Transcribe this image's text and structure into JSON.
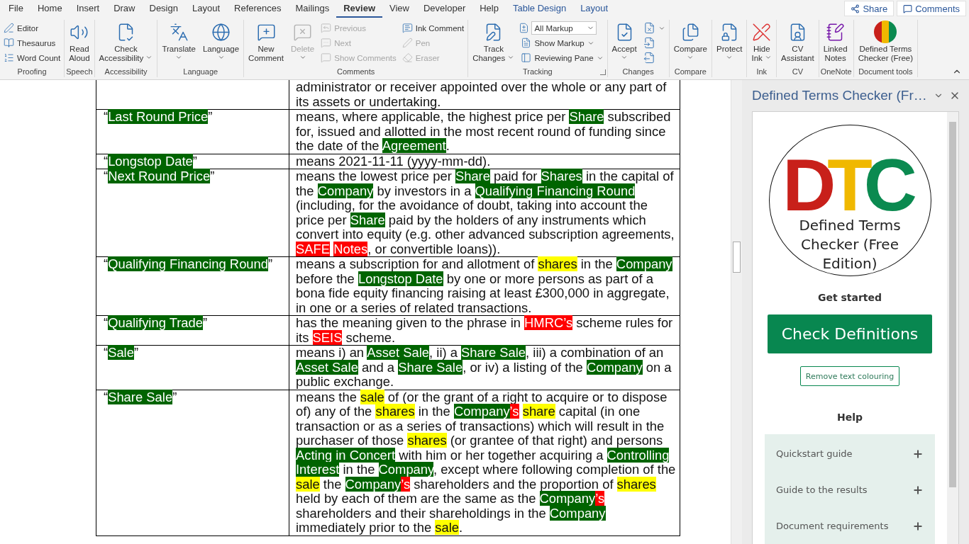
{
  "menu_tabs": [
    {
      "label": "File",
      "selected": false,
      "kind": "main"
    },
    {
      "label": "Home",
      "selected": false,
      "kind": "main"
    },
    {
      "label": "Insert",
      "selected": false,
      "kind": "main"
    },
    {
      "label": "Draw",
      "selected": false,
      "kind": "main"
    },
    {
      "label": "Design",
      "selected": false,
      "kind": "main"
    },
    {
      "label": "Layout",
      "selected": false,
      "kind": "main"
    },
    {
      "label": "References",
      "selected": false,
      "kind": "main"
    },
    {
      "label": "Mailings",
      "selected": false,
      "kind": "main"
    },
    {
      "label": "Review",
      "selected": true,
      "kind": "main"
    },
    {
      "label": "View",
      "selected": false,
      "kind": "main"
    },
    {
      "label": "Developer",
      "selected": false,
      "kind": "main"
    },
    {
      "label": "Help",
      "selected": false,
      "kind": "main"
    },
    {
      "label": "Table Design",
      "selected": false,
      "kind": "contextual"
    },
    {
      "label": "Layout",
      "selected": false,
      "kind": "contextual"
    }
  ],
  "share_button": "Share",
  "comments_button": "Comments",
  "ribbon_groups": [
    {
      "label": "Proofing",
      "items": [
        {
          "kind": "stack",
          "items": [
            {
              "kind": "small",
              "label": "Editor",
              "disabled": false
            },
            {
              "kind": "small",
              "label": "Thesaurus",
              "disabled": false
            },
            {
              "kind": "small",
              "label": "Word Count",
              "disabled": false
            }
          ]
        }
      ]
    },
    {
      "label": "Speech",
      "items": [
        {
          "kind": "large",
          "label": "Read\nAloud",
          "disabled": false
        }
      ]
    },
    {
      "label": "Accessibility",
      "items": [
        {
          "kind": "large",
          "label": "Check\nAccessibility",
          "menu": true,
          "disabled": false
        }
      ]
    },
    {
      "label": "Language",
      "items": [
        {
          "kind": "large",
          "label": "Translate",
          "menu": true,
          "disabled": false
        },
        {
          "kind": "large",
          "label": "Language",
          "menu": true,
          "disabled": false
        }
      ]
    },
    {
      "label": "Comments",
      "items": [
        {
          "kind": "large",
          "label": "New\nComment",
          "disabled": false
        },
        {
          "kind": "large",
          "label": "Delete",
          "menu": true,
          "disabled": true
        },
        {
          "kind": "stack",
          "items": [
            {
              "kind": "small",
              "label": "Previous",
              "disabled": true
            },
            {
              "kind": "small",
              "label": "Next",
              "disabled": true
            },
            {
              "kind": "small",
              "label": "Show Comments",
              "disabled": true
            }
          ]
        },
        {
          "kind": "stack",
          "items": [
            {
              "kind": "small",
              "label": "Ink Comment",
              "disabled": false
            },
            {
              "kind": "small",
              "label": "Pen",
              "disabled": true
            },
            {
              "kind": "small",
              "label": "Eraser",
              "disabled": true
            }
          ]
        }
      ]
    },
    {
      "label": "Tracking",
      "launcher": true,
      "items": [
        {
          "kind": "large",
          "label": "Track\nChanges",
          "menu": true,
          "disabled": false
        },
        {
          "kind": "stack",
          "items": [
            {
              "kind": "select",
              "label": "All Markup"
            },
            {
              "kind": "small",
              "label": "Show Markup",
              "menu": true,
              "disabled": false
            },
            {
              "kind": "small",
              "label": "Reviewing Pane",
              "menu": true,
              "disabled": false
            }
          ]
        }
      ]
    },
    {
      "label": "Changes",
      "items": [
        {
          "kind": "large",
          "label": "Accept",
          "menu": true,
          "disabled": false
        },
        {
          "kind": "stack",
          "items": [
            {
              "kind": "icon",
              "menu": true,
              "disabled": false
            },
            {
              "kind": "icon",
              "disabled": false
            },
            {
              "kind": "icon",
              "disabled": false
            }
          ]
        }
      ]
    },
    {
      "label": "Compare",
      "items": [
        {
          "kind": "large",
          "label": "Compare",
          "menu": true,
          "disabled": false
        }
      ]
    },
    {
      "items": [
        {
          "kind": "large",
          "label": "Protect",
          "menu": true,
          "disabled": false
        }
      ]
    },
    {
      "label": "Ink",
      "items": [
        {
          "kind": "large",
          "label": "Hide\nInk",
          "menu": true,
          "disabled": false
        }
      ]
    },
    {
      "label": "CV",
      "items": [
        {
          "kind": "large",
          "label": "CV\nAssistant",
          "disabled": false
        }
      ]
    },
    {
      "label": "OneNote",
      "items": [
        {
          "kind": "large",
          "label": "Linked\nNotes",
          "disabled": false
        }
      ]
    },
    {
      "label": "Document tools",
      "items": [
        {
          "kind": "large",
          "label": "Defined Terms\nChecker (Free)",
          "disabled": false
        }
      ]
    }
  ],
  "table": {
    "rows": [
      {
        "term": [],
        "definition": [
          {
            "text": "administrator or receiver appointed over the whole or any part of its assets or undertaking."
          }
        ]
      },
      {
        "term": [
          {
            "text": "“"
          },
          {
            "text": "Last Round Price",
            "color": "#006400"
          },
          {
            "text": "”"
          }
        ],
        "definition": [
          {
            "text": "means, where applicable, the highest price per "
          },
          {
            "text": "Share",
            "color": "#006400"
          },
          {
            "text": " subscribed for, issued and allotted in the most recent round of funding since the date of the "
          },
          {
            "text": "Agreement",
            "color": "#006400"
          },
          {
            "text": "."
          }
        ]
      },
      {
        "term": [
          {
            "text": "“"
          },
          {
            "text": "Longstop Date",
            "color": "#006400"
          },
          {
            "text": "”"
          }
        ],
        "definition": [
          {
            "text": "means 2021-11-11 (yyyy-mm-dd)."
          }
        ]
      },
      {
        "term": [
          {
            "text": "“"
          },
          {
            "text": "Next Round Price",
            "color": "#006400"
          },
          {
            "text": "”"
          }
        ],
        "definition": [
          {
            "text": "means the lowest price per "
          },
          {
            "text": "Share",
            "color": "#006400"
          },
          {
            "text": " paid for "
          },
          {
            "text": "Shares",
            "color": "#006400"
          },
          {
            "text": " in the capital of the "
          },
          {
            "text": "Company",
            "color": "#006400"
          },
          {
            "text": " by investors in a "
          },
          {
            "text": "Qualifying Financing Round",
            "color": "#006400"
          },
          {
            "text": " (including, for the avoidance of doubt, taking into account the price per "
          },
          {
            "text": "Share",
            "color": "#006400"
          },
          {
            "text": " paid by the holders of any instruments which convert into equity (e.g. other advanced subscription agreements, "
          },
          {
            "text": "SAFE",
            "color": "#ff0000"
          },
          {
            "text": "Notes",
            "color": "#ff0000",
            "space_before": true
          },
          {
            "text": ", or convertible loans))."
          }
        ]
      },
      {
        "term": [
          {
            "text": "“"
          },
          {
            "text": "Qualifying Financing Round",
            "color": "#006400"
          },
          {
            "text": "”"
          }
        ],
        "definition": [
          {
            "text": "means a subscription for and allotment of "
          },
          {
            "text": "shares",
            "color": "#ffff00"
          },
          {
            "text": " in the "
          },
          {
            "text": "Company",
            "color": "#006400"
          },
          {
            "text": " before the "
          },
          {
            "text": "Longstop Date",
            "color": "#006400"
          },
          {
            "text": " by one or more persons as part of a bona fide equity financing raising at least £300,000 in aggregate, in one or a series of related transactions."
          }
        ]
      },
      {
        "term": [
          {
            "text": "“"
          },
          {
            "text": "Qualifying Trade",
            "color": "#006400"
          },
          {
            "text": "”"
          }
        ],
        "definition": [
          {
            "text": "has the meaning given to the phrase in "
          },
          {
            "text": "HMRC’s",
            "color": "#ff0000"
          },
          {
            "text": " scheme rules for its "
          },
          {
            "text": "SEIS",
            "color": "#ff0000"
          },
          {
            "text": " scheme."
          }
        ]
      },
      {
        "term": [
          {
            "text": "“"
          },
          {
            "text": "Sale",
            "color": "#006400"
          },
          {
            "text": "”"
          }
        ],
        "definition": [
          {
            "text": "means i) an "
          },
          {
            "text": "Asset Sale",
            "color": "#006400"
          },
          {
            "text": ", ii) a "
          },
          {
            "text": "Share Sale",
            "color": "#006400"
          },
          {
            "text": ", iii) a combination of an "
          },
          {
            "text": "Asset Sale",
            "color": "#006400"
          },
          {
            "text": " and a "
          },
          {
            "text": "Share Sale",
            "color": "#006400"
          },
          {
            "text": ", or iv) a listing of the "
          },
          {
            "text": "Company",
            "color": "#006400"
          },
          {
            "text": " on a public exchange."
          }
        ]
      },
      {
        "term": [
          {
            "text": "“"
          },
          {
            "text": "Share Sale",
            "color": "#006400"
          },
          {
            "text": "”"
          }
        ],
        "definition": [
          {
            "text": "means the "
          },
          {
            "text": "sale",
            "color": "#ffff00"
          },
          {
            "text": " of (or the grant of a right to acquire or to dispose of) any of the "
          },
          {
            "text": "shares",
            "color": "#ffff00"
          },
          {
            "text": " in the "
          },
          {
            "text": "Company",
            "color": "#006400"
          },
          {
            "text": "’s",
            "color": "#ff0000"
          },
          {
            "text": "share",
            "color": "#ffff00",
            "space_before": true
          },
          {
            "text": " capital (in one transaction or as a series of transactions) which will result in the purchaser of those "
          },
          {
            "text": "shares",
            "color": "#ffff00"
          },
          {
            "text": " (or grantee of that right) and persons "
          },
          {
            "text": "Acting in Concert",
            "color": "#006400"
          },
          {
            "text": " with him or her together acquiring a "
          },
          {
            "text": "Controlling Interest",
            "color": "#006400"
          },
          {
            "text": " in the "
          },
          {
            "text": "Company",
            "color": "#006400"
          },
          {
            "text": ", except where following completion of the "
          },
          {
            "text": "sale",
            "color": "#ffff00"
          },
          {
            "text": " the "
          },
          {
            "text": "Company",
            "color": "#006400"
          },
          {
            "text": "’s",
            "color": "#ff0000"
          },
          {
            "text": " shareholders and the proportion of "
          },
          {
            "text": "shares",
            "color": "#ffff00"
          },
          {
            "text": " held by each of them are the same as the "
          },
          {
            "text": "Company",
            "color": "#006400"
          },
          {
            "text": "’s",
            "color": "#ff0000"
          },
          {
            "text": " shareholders and their shareholdings in the "
          },
          {
            "text": "Company",
            "color": "#006400"
          },
          {
            "text": " immediately prior to the "
          },
          {
            "text": "sale",
            "color": "#ffff00"
          },
          {
            "text": "."
          }
        ]
      }
    ]
  },
  "pane": {
    "title": "Defined Terms Checker (Fr…",
    "logo_letters": [
      {
        "text": "D",
        "color": "#c8201a"
      },
      {
        "text": "T",
        "color": "#f0b800"
      },
      {
        "text": "C",
        "color": "#0b8a50"
      }
    ],
    "logo_caption": "Defined Terms Checker (Free Edition)",
    "get_started": "Get started",
    "check_button": "Check Definitions",
    "remove_button": "Remove text colouring",
    "help_heading": "Help",
    "help_items": [
      {
        "label": "Quickstart guide",
        "expanded": false
      },
      {
        "label": "Guide to the results",
        "expanded": false
      },
      {
        "label": "Document requirements",
        "expanded": false
      }
    ]
  }
}
